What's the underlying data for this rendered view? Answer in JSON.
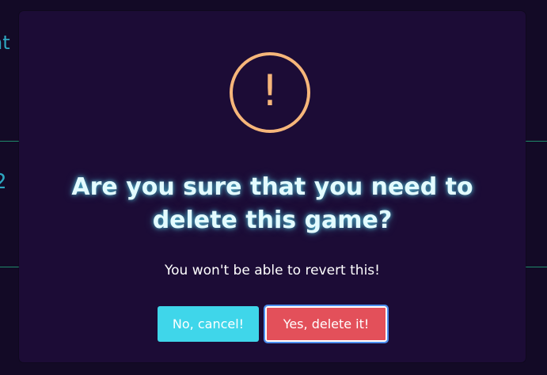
{
  "background": {
    "fragment_top": "nt",
    "fragment_mid": "2"
  },
  "dialog": {
    "icon": "warning-exclamation-icon",
    "icon_glyph": "!",
    "title": "Are you sure that you need to delete this game?",
    "message": "You won't be able to revert this!",
    "cancel_label": "No, cancel!",
    "confirm_label": "Yes, delete it!"
  },
  "colors": {
    "background": "#130a26",
    "modal": "#1c0c36",
    "warning": "#f6b67a",
    "title_glow": "#5febff",
    "cancel_button": "#3fd6ea",
    "confirm_button": "#e3505a",
    "focus_ring": "#4b8ff0"
  }
}
